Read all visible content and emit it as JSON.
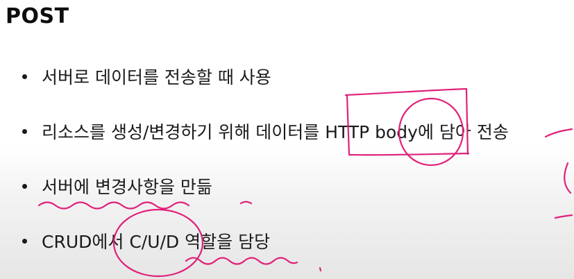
{
  "slide": {
    "title": "POST",
    "bullets": [
      "서버로 데이터를 전송할 때 사용",
      "리소스를 생성/변경하기 위해 데이터를 HTTP body에 담아 전송",
      "서버에 변경사항을 만듦",
      "CRUD에서 C/U/D 역할을 담당"
    ]
  },
  "colors": {
    "text": "#1a1a1a",
    "annotation": "#e0207a",
    "background": "#ffffff"
  },
  "annotations": {
    "marks": [
      "box-around-http",
      "circle-around-body",
      "underline-wave-bullet-3",
      "circle-around-cud",
      "underline-wave-bullet-4"
    ]
  }
}
